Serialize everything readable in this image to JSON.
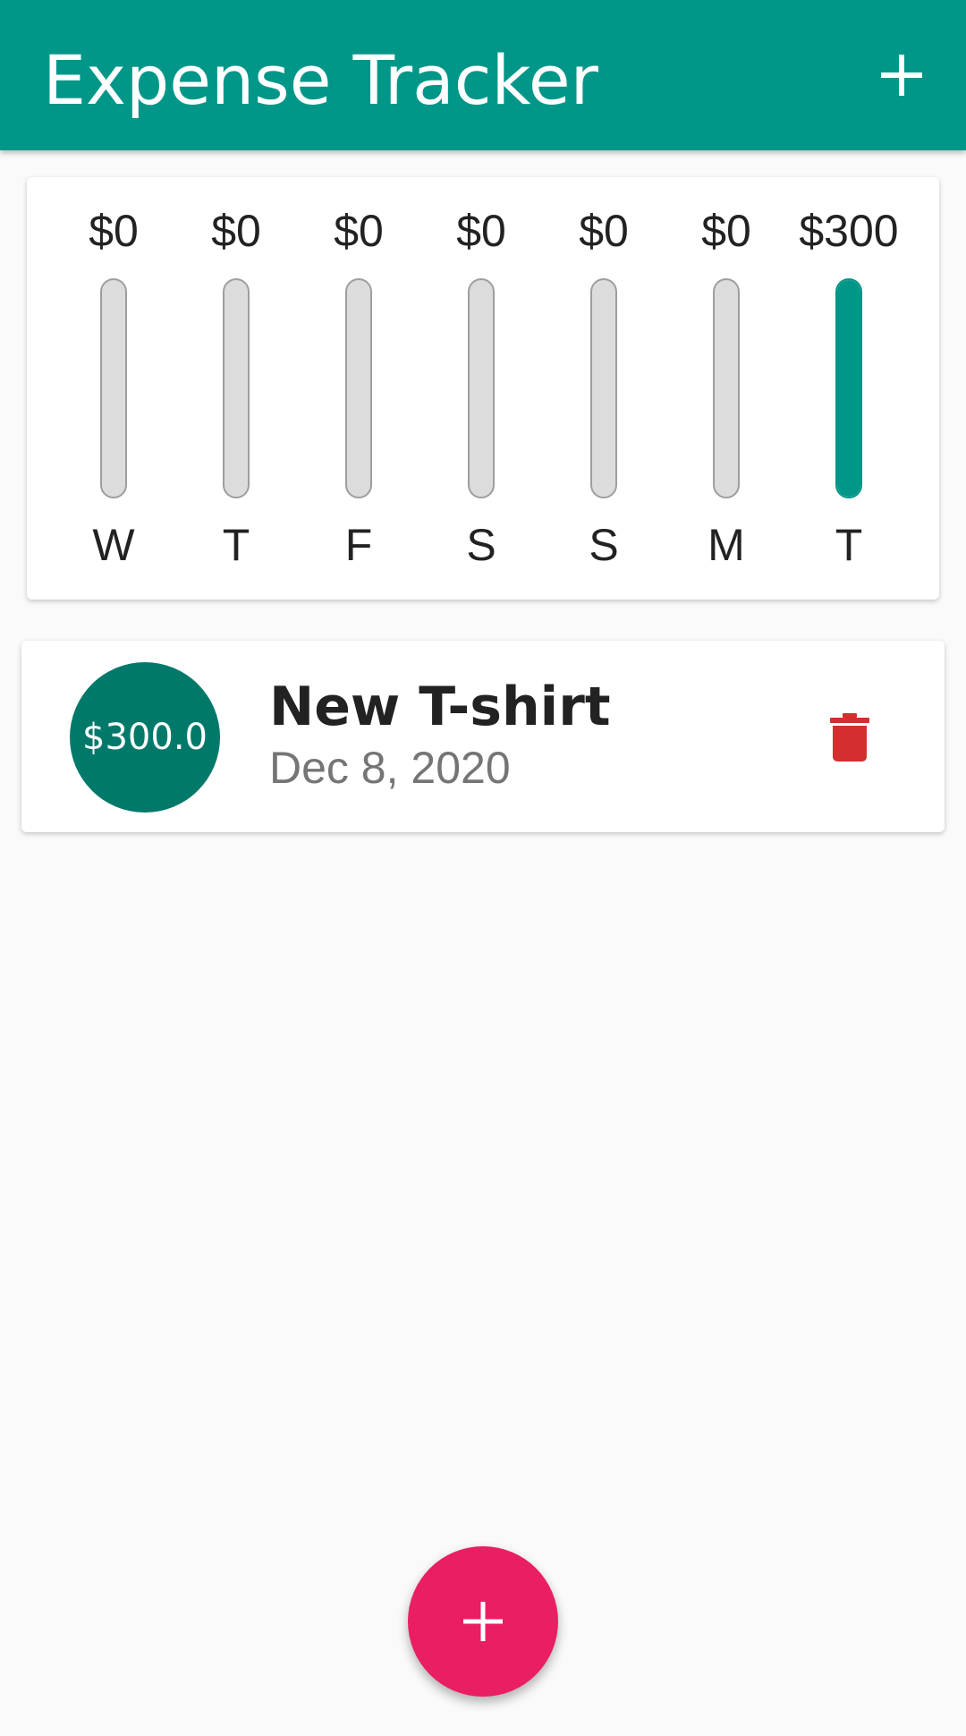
{
  "app": {
    "title": "Expense Tracker",
    "add_icon": "plus-icon",
    "colors": {
      "primary": "#009688",
      "primary_dark": "#00796b",
      "accent": "#e91e63",
      "danger": "#d32f2f",
      "bar_empty": "#dcdcdc",
      "background": "#fafafa"
    }
  },
  "chart_data": {
    "type": "bar",
    "categories": [
      "W",
      "T",
      "F",
      "S",
      "S",
      "M",
      "T"
    ],
    "labels": [
      "$0",
      "$0",
      "$0",
      "$0",
      "$0",
      "$0",
      "$300"
    ],
    "values": [
      0,
      0,
      0,
      0,
      0,
      0,
      300
    ],
    "fill_fractions": [
      0,
      0,
      0,
      0,
      0,
      0,
      1
    ]
  },
  "transactions": [
    {
      "amount": "$300.0",
      "title": "New T-shirt",
      "date": "Dec 8, 2020",
      "delete_icon": "trash-icon"
    }
  ],
  "fab": {
    "icon": "plus-icon"
  }
}
